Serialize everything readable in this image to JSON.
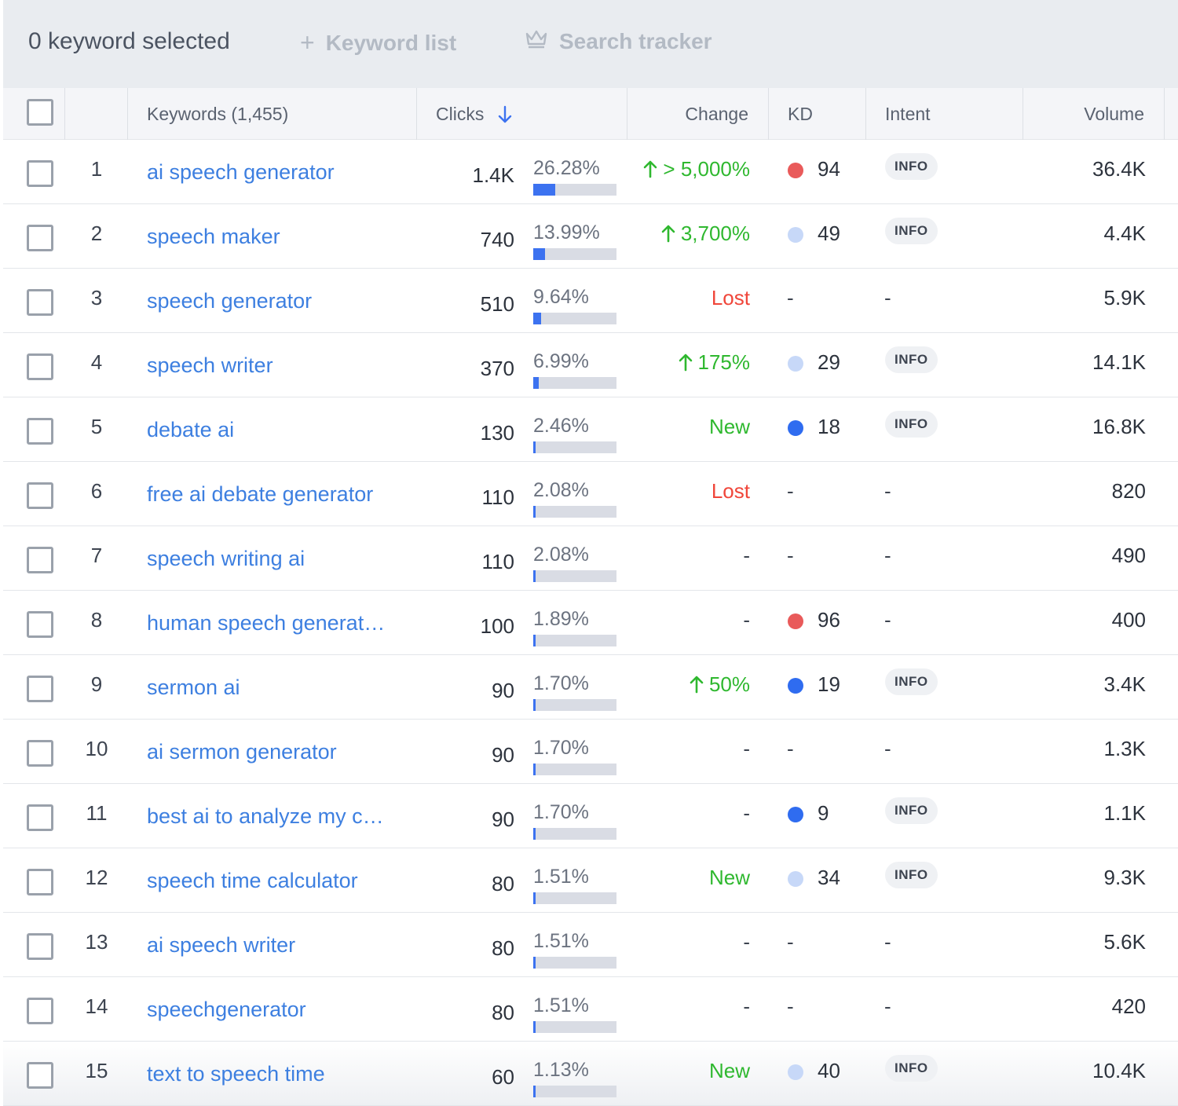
{
  "toolbar": {
    "selected_label": "0 keyword selected",
    "keyword_list_label": "Keyword list",
    "search_tracker_label": "Search tracker"
  },
  "columns": {
    "keywords": "Keywords (1,455)",
    "clicks": "Clicks",
    "change": "Change",
    "kd": "KD",
    "intent": "Intent",
    "volume": "Volume"
  },
  "colors": {
    "kd_red": "#e95a5a",
    "kd_lightblue": "#c7d8f8",
    "kd_blue": "#2f6cf0",
    "link": "#3d7fe0",
    "up": "#2fb82f",
    "lost": "#f0463a"
  },
  "rows": [
    {
      "num": "1",
      "keyword": "ai speech generator",
      "clicks": "1.4K",
      "pct": "26.28%",
      "share": 0.2628,
      "change": "> 5,000%",
      "change_type": "up",
      "kd": "94",
      "kd_color": "red",
      "intent": "INFO",
      "volume": "36.4K"
    },
    {
      "num": "2",
      "keyword": "speech maker",
      "clicks": "740",
      "pct": "13.99%",
      "share": 0.1399,
      "change": "3,700%",
      "change_type": "up",
      "kd": "49",
      "kd_color": "lightblue",
      "intent": "INFO",
      "volume": "4.4K"
    },
    {
      "num": "3",
      "keyword": "speech generator",
      "clicks": "510",
      "pct": "9.64%",
      "share": 0.0964,
      "change": "Lost",
      "change_type": "lost",
      "kd": "-",
      "kd_color": "",
      "intent": "-",
      "volume": "5.9K"
    },
    {
      "num": "4",
      "keyword": "speech writer",
      "clicks": "370",
      "pct": "6.99%",
      "share": 0.0699,
      "change": "175%",
      "change_type": "up",
      "kd": "29",
      "kd_color": "lightblue",
      "intent": "INFO",
      "volume": "14.1K"
    },
    {
      "num": "5",
      "keyword": "debate ai",
      "clicks": "130",
      "pct": "2.46%",
      "share": 0.0246,
      "change": "New",
      "change_type": "new",
      "kd": "18",
      "kd_color": "blue",
      "intent": "INFO",
      "volume": "16.8K"
    },
    {
      "num": "6",
      "keyword": "free ai debate generator",
      "clicks": "110",
      "pct": "2.08%",
      "share": 0.0208,
      "change": "Lost",
      "change_type": "lost",
      "kd": "-",
      "kd_color": "",
      "intent": "-",
      "volume": "820"
    },
    {
      "num": "7",
      "keyword": "speech writing ai",
      "clicks": "110",
      "pct": "2.08%",
      "share": 0.0208,
      "change": "-",
      "change_type": "none",
      "kd": "-",
      "kd_color": "",
      "intent": "-",
      "volume": "490"
    },
    {
      "num": "8",
      "keyword": "human speech generat…",
      "clicks": "100",
      "pct": "1.89%",
      "share": 0.0189,
      "change": "-",
      "change_type": "none",
      "kd": "96",
      "kd_color": "red",
      "intent": "-",
      "volume": "400"
    },
    {
      "num": "9",
      "keyword": "sermon ai",
      "clicks": "90",
      "pct": "1.70%",
      "share": 0.017,
      "change": "50%",
      "change_type": "up",
      "kd": "19",
      "kd_color": "blue",
      "intent": "INFO",
      "volume": "3.4K"
    },
    {
      "num": "10",
      "keyword": "ai sermon generator",
      "clicks": "90",
      "pct": "1.70%",
      "share": 0.017,
      "change": "-",
      "change_type": "none",
      "kd": "-",
      "kd_color": "",
      "intent": "-",
      "volume": "1.3K"
    },
    {
      "num": "11",
      "keyword": "best ai to analyze my c…",
      "clicks": "90",
      "pct": "1.70%",
      "share": 0.017,
      "change": "-",
      "change_type": "none",
      "kd": "9",
      "kd_color": "blue",
      "intent": "INFO",
      "volume": "1.1K"
    },
    {
      "num": "12",
      "keyword": "speech time calculator",
      "clicks": "80",
      "pct": "1.51%",
      "share": 0.0151,
      "change": "New",
      "change_type": "new",
      "kd": "34",
      "kd_color": "lightblue",
      "intent": "INFO",
      "volume": "9.3K"
    },
    {
      "num": "13",
      "keyword": "ai speech writer",
      "clicks": "80",
      "pct": "1.51%",
      "share": 0.0151,
      "change": "-",
      "change_type": "none",
      "kd": "-",
      "kd_color": "",
      "intent": "-",
      "volume": "5.6K"
    },
    {
      "num": "14",
      "keyword": "speechgenerator",
      "clicks": "80",
      "pct": "1.51%",
      "share": 0.0151,
      "change": "-",
      "change_type": "none",
      "kd": "-",
      "kd_color": "",
      "intent": "-",
      "volume": "420"
    },
    {
      "num": "15",
      "keyword": "text to speech time",
      "clicks": "60",
      "pct": "1.13%",
      "share": 0.0113,
      "change": "New",
      "change_type": "new",
      "kd": "40",
      "kd_color": "lightblue",
      "intent": "INFO",
      "volume": "10.4K"
    }
  ]
}
